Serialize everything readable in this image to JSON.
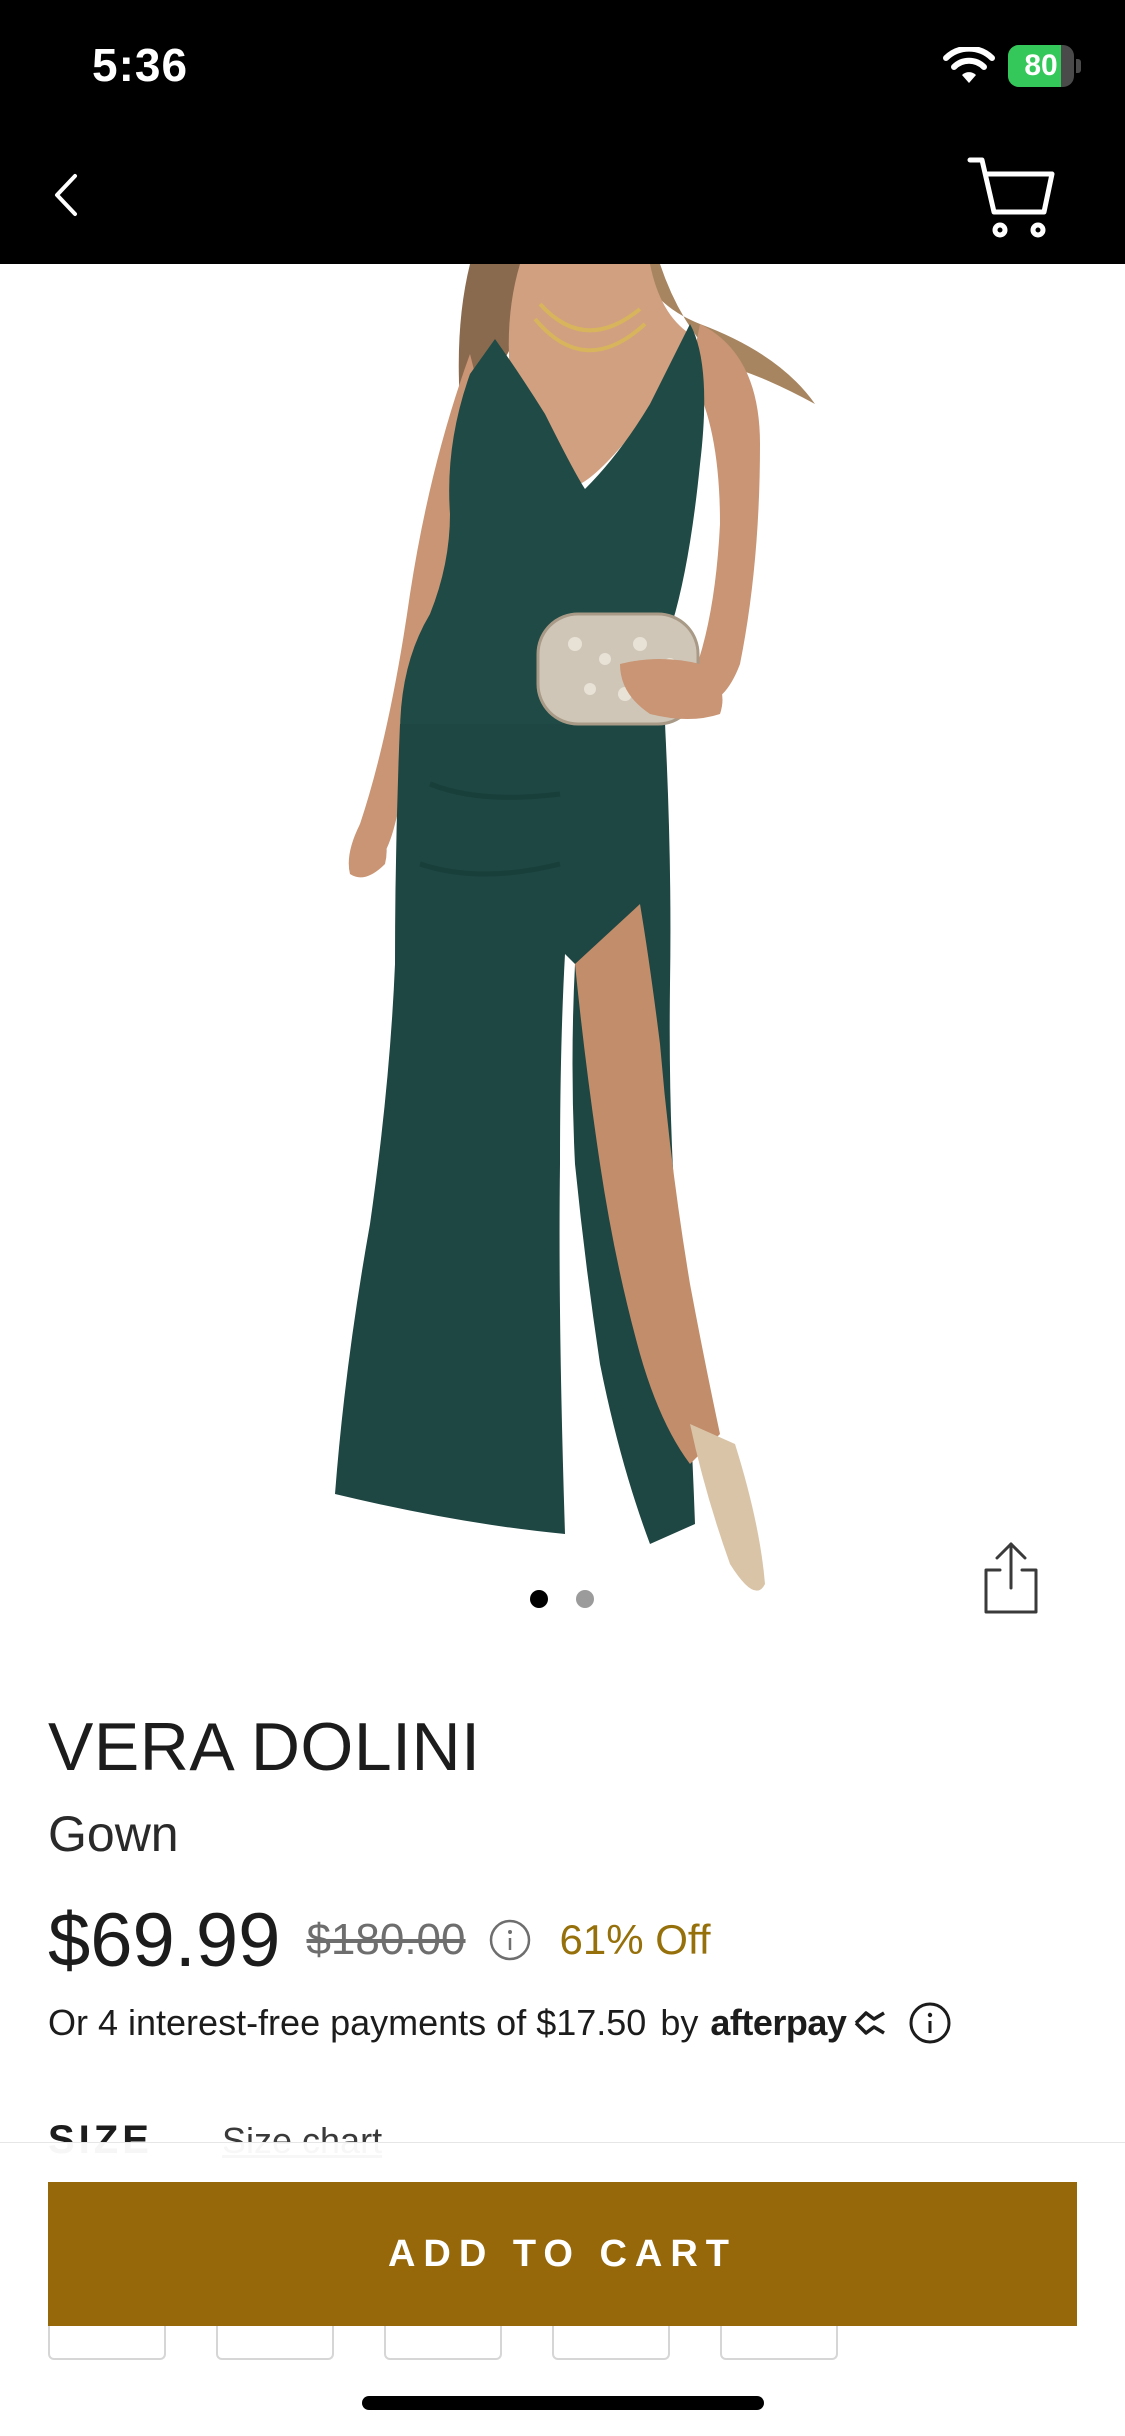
{
  "status_bar": {
    "time": "5:36",
    "battery_percent": "80",
    "battery_level": 0.8
  },
  "nav": {
    "back_icon": "chevron-left-icon",
    "cart_icon": "shopping-cart-icon"
  },
  "gallery": {
    "image_count": 2,
    "active_index": 0,
    "share_icon": "share-icon"
  },
  "product": {
    "brand": "VERA DOLINI",
    "name": "Gown",
    "price": "$69.99",
    "original_price": "$180.00",
    "discount": "61% Off",
    "afterpay_text": "Or 4 interest-free payments of $17.50",
    "afterpay_by": "by",
    "afterpay_logo": "afterpay"
  },
  "size": {
    "label": "SIZE",
    "chart_link": "Size chart"
  },
  "actions": {
    "add_to_cart": "ADD TO CART"
  },
  "colors": {
    "accent": "#96680a",
    "discount": "#96700a",
    "dress": "#1f4a45",
    "header": "#000000"
  }
}
